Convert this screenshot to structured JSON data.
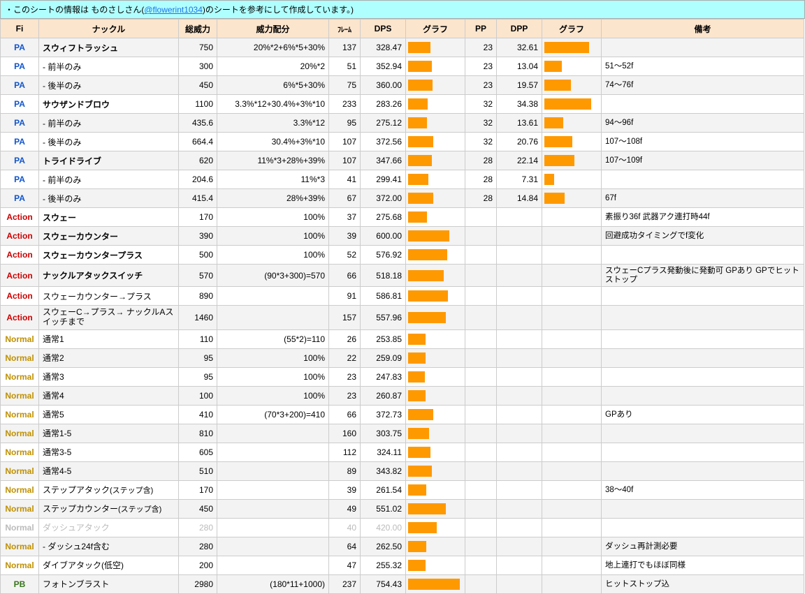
{
  "note": {
    "prefix": "・このシートの情報は ものさしさん(",
    "handle": "@flowerint1034",
    "suffix": ")のシートを参考にして作成しています。)"
  },
  "headers": {
    "fi": "Fi",
    "name": "ナックル",
    "sou": "総威力",
    "iryo": "威力配分",
    "frame": "ﾌﾚｰﾑ",
    "dps": "DPS",
    "graph1": "グラフ",
    "pp": "PP",
    "dpp": "DPP",
    "graph2": "グラフ",
    "note": "備考"
  },
  "maxDps": 800,
  "maxDpp": 40,
  "rows": [
    {
      "fi": "PA",
      "name": "スウィフトラッシュ",
      "sou": "750",
      "iryo": "20%*2+6%*5+30%",
      "frame": "137",
      "dps": "328.47",
      "pp": "23",
      "dpp": "32.61",
      "note": "",
      "even": true,
      "bold": true
    },
    {
      "fi": "PA",
      "name": " - 前半のみ",
      "sou": "300",
      "iryo": "20%*2",
      "frame": "51",
      "dps": "352.94",
      "pp": "23",
      "dpp": "13.04",
      "note": "51～52f",
      "even": false
    },
    {
      "fi": "PA",
      "name": " - 後半のみ",
      "sou": "450",
      "iryo": "6%*5+30%",
      "frame": "75",
      "dps": "360.00",
      "pp": "23",
      "dpp": "19.57",
      "note": "74～76f",
      "even": true
    },
    {
      "fi": "PA",
      "name": "サウザンドブロウ",
      "sou": "1100",
      "iryo": "3.3%*12+30.4%+3%*10",
      "frame": "233",
      "dps": "283.26",
      "pp": "32",
      "dpp": "34.38",
      "note": "",
      "even": false,
      "bold": true
    },
    {
      "fi": "PA",
      "name": " - 前半のみ",
      "sou": "435.6",
      "iryo": "3.3%*12",
      "frame": "95",
      "dps": "275.12",
      "pp": "32",
      "dpp": "13.61",
      "note": "94～96f",
      "even": true
    },
    {
      "fi": "PA",
      "name": " - 後半のみ",
      "sou": "664.4",
      "iryo": "30.4%+3%*10",
      "frame": "107",
      "dps": "372.56",
      "pp": "32",
      "dpp": "20.76",
      "note": "107～108f",
      "even": false
    },
    {
      "fi": "PA",
      "name": "トライドライブ",
      "sou": "620",
      "iryo": "11%*3+28%+39%",
      "frame": "107",
      "dps": "347.66",
      "pp": "28",
      "dpp": "22.14",
      "note": "107～109f",
      "even": true,
      "bold": true
    },
    {
      "fi": "PA",
      "name": " - 前半のみ",
      "sou": "204.6",
      "iryo": "11%*3",
      "frame": "41",
      "dps": "299.41",
      "pp": "28",
      "dpp": "7.31",
      "note": "",
      "even": false
    },
    {
      "fi": "PA",
      "name": " - 後半のみ",
      "sou": "415.4",
      "iryo": "28%+39%",
      "frame": "67",
      "dps": "372.00",
      "pp": "28",
      "dpp": "14.84",
      "note": "67f",
      "even": true
    },
    {
      "fi": "Action",
      "name": "スウェー",
      "sou": "170",
      "iryo": "100%",
      "frame": "37",
      "dps": "275.68",
      "pp": "",
      "dpp": "",
      "note": "素振り36f 武器アク連打時44f",
      "noteSmall": true,
      "even": false,
      "bold": true
    },
    {
      "fi": "Action",
      "name": "スウェーカウンター",
      "sou": "390",
      "iryo": "100%",
      "frame": "39",
      "dps": "600.00",
      "pp": "",
      "dpp": "",
      "note": "回避成功タイミングでf変化",
      "even": true,
      "bold": true
    },
    {
      "fi": "Action",
      "name": "スウェーカウンタープラス",
      "sou": "500",
      "iryo": "100%",
      "frame": "52",
      "dps": "576.92",
      "pp": "",
      "dpp": "",
      "note": "",
      "even": false,
      "bold": true
    },
    {
      "fi": "Action",
      "name": "ナックルアタックスイッチ",
      "sou": "570",
      "iryo": "(90*3+300)=570",
      "frame": "66",
      "dps": "518.18",
      "pp": "",
      "dpp": "",
      "note": "スウェーCプラス発動後に発動可 GPあり GPでヒットストップ",
      "noteSmall": true,
      "even": true,
      "bold": true
    },
    {
      "fi": "Action",
      "name": "スウェーカウンター→プラス",
      "sou": "890",
      "iryo": "",
      "frame": "91",
      "dps": "586.81",
      "pp": "",
      "dpp": "",
      "note": "",
      "even": false
    },
    {
      "fi": "Action",
      "name": "スウェーC→プラス→\nナックルAスイッチまで",
      "sou": "1460",
      "iryo": "",
      "frame": "157",
      "dps": "557.96",
      "pp": "",
      "dpp": "",
      "note": "",
      "even": true,
      "multiline": true
    },
    {
      "fi": "Normal",
      "name": "通常1",
      "sou": "110",
      "iryo": "(55*2)=110",
      "frame": "26",
      "dps": "253.85",
      "pp": "",
      "dpp": "",
      "note": "",
      "even": false
    },
    {
      "fi": "Normal",
      "name": "通常2",
      "sou": "95",
      "iryo": "100%",
      "frame": "22",
      "dps": "259.09",
      "pp": "",
      "dpp": "",
      "note": "",
      "even": true
    },
    {
      "fi": "Normal",
      "name": "通常3",
      "sou": "95",
      "iryo": "100%",
      "frame": "23",
      "dps": "247.83",
      "pp": "",
      "dpp": "",
      "note": "",
      "even": false
    },
    {
      "fi": "Normal",
      "name": "通常4",
      "sou": "100",
      "iryo": "100%",
      "frame": "23",
      "dps": "260.87",
      "pp": "",
      "dpp": "",
      "note": "",
      "even": true
    },
    {
      "fi": "Normal",
      "name": "通常5",
      "sou": "410",
      "iryo": "(70*3+200)=410",
      "frame": "66",
      "dps": "372.73",
      "pp": "",
      "dpp": "",
      "note": "GPあり",
      "even": false
    },
    {
      "fi": "Normal",
      "name": "通常1-5",
      "sou": "810",
      "iryo": "",
      "frame": "160",
      "dps": "303.75",
      "pp": "",
      "dpp": "",
      "note": "",
      "even": true
    },
    {
      "fi": "Normal",
      "name": "通常3-5",
      "sou": "605",
      "iryo": "",
      "frame": "112",
      "dps": "324.11",
      "pp": "",
      "dpp": "",
      "note": "",
      "even": false
    },
    {
      "fi": "Normal",
      "name": "通常4-5",
      "sou": "510",
      "iryo": "",
      "frame": "89",
      "dps": "343.82",
      "pp": "",
      "dpp": "",
      "note": "",
      "even": true
    },
    {
      "fi": "Normal",
      "name": "ステップアタック(ステップ含)",
      "nameSub": true,
      "sou": "170",
      "iryo": "",
      "frame": "39",
      "dps": "261.54",
      "pp": "",
      "dpp": "",
      "note": "38～40f",
      "even": false
    },
    {
      "fi": "Normal",
      "name": "ステップカウンター(ステップ含)",
      "nameSub": true,
      "sou": "450",
      "iryo": "",
      "frame": "49",
      "dps": "551.02",
      "pp": "",
      "dpp": "",
      "note": "",
      "even": true
    },
    {
      "fi": "Normal",
      "name": "ダッシュアタック",
      "sou": "280",
      "iryo": "",
      "frame": "40",
      "dps": "420.00",
      "pp": "",
      "dpp": "",
      "note": "",
      "even": false,
      "dim": true
    },
    {
      "fi": "Normal",
      "name": " - ダッシュ24f含む",
      "sou": "280",
      "iryo": "",
      "frame": "64",
      "dps": "262.50",
      "pp": "",
      "dpp": "",
      "note": "ダッシュ再計測必要",
      "even": true
    },
    {
      "fi": "Normal",
      "name": "ダイブアタック(低空)",
      "sou": "200",
      "iryo": "",
      "frame": "47",
      "dps": "255.32",
      "pp": "",
      "dpp": "",
      "note": "地上連打でもほぼ同様",
      "even": false
    },
    {
      "fi": "PB",
      "name": "フォトンブラスト",
      "sou": "2980",
      "iryo": "(180*11+1000)",
      "frame": "237",
      "dps": "754.43",
      "pp": "",
      "dpp": "",
      "note": "ヒットストップ込",
      "even": true
    }
  ]
}
